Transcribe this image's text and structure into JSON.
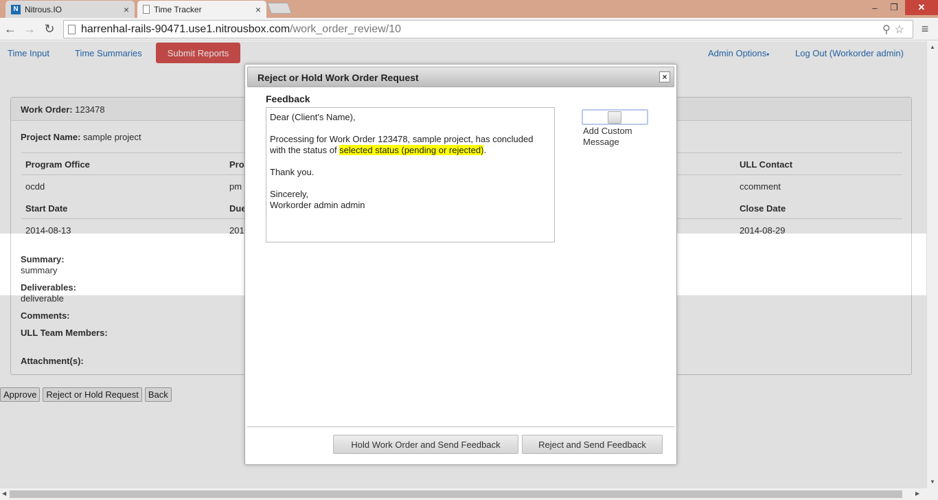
{
  "browser": {
    "tabs": [
      {
        "label": "Nitrous.IO",
        "icon": "nitrous-logo-icon"
      },
      {
        "label": "Time Tracker",
        "icon": "page-icon"
      }
    ],
    "url_host": "harrenhal-rails-90471.use1.nitrousbox.com",
    "url_path": "/work_order_review/10"
  },
  "nav": {
    "time_input": "Time Input",
    "time_summaries": "Time Summaries",
    "submit_reports": "Submit Reports",
    "admin_options": "Admin Options",
    "logout": "Log Out (Workorder admin)"
  },
  "work_order": {
    "label": "Work Order:",
    "number": "123478",
    "project_label": "Project Name:",
    "project_name": "sample project",
    "headers_row1": [
      "Program Office",
      "Pro",
      "ULL Contact"
    ],
    "values_row1": [
      "ocdd",
      "pm",
      "ccomment"
    ],
    "headers_row2": [
      "Start Date",
      "Due",
      "Close Date"
    ],
    "values_row2": [
      "2014-08-13",
      "201",
      "2014-08-29"
    ],
    "summary_label": "Summary:",
    "summary": "summary",
    "deliverables_label": "Deliverables:",
    "deliverables": "deliverable",
    "comments_label": "Comments:",
    "team_label": "ULL Team Members:",
    "attachments_label": "Attachment(s):"
  },
  "actions": {
    "approve": "Approve",
    "reject_hold": "Reject or Hold Request",
    "back": "Back"
  },
  "modal": {
    "title": "Reject or Hold Work Order Request",
    "close": "×",
    "feedback_label": "Feedback",
    "greeting": "Dear (Client's Name),",
    "body_before": "Processing for Work Order 123478, sample project, has concluded with the status of ",
    "body_highlight": "selected status (pending or rejected)",
    "body_after": ".",
    "thanks": "Thank you.",
    "signoff": "Sincerely,",
    "signature": "Workorder admin admin",
    "custom_message_label": "Add Custom Message",
    "custom_message_enabled": false,
    "hold_button": "Hold Work Order and Send Feedback",
    "reject_button": "Reject and Send Feedback"
  },
  "colors": {
    "submit_button": "#d9534f",
    "link": "#2a6fb8",
    "highlight": "#ffff00"
  }
}
